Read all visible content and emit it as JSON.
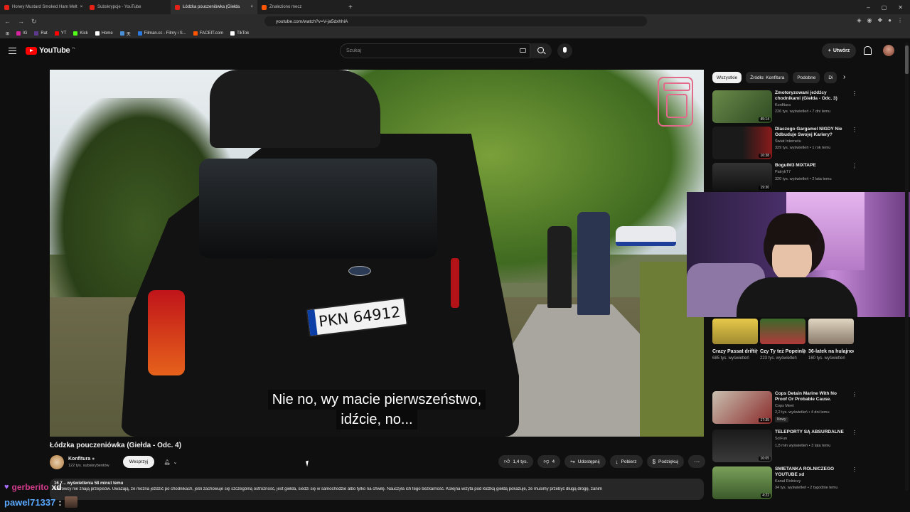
{
  "browser": {
    "tabs": [
      {
        "label": "Honey Mustard Smoked Ham Melt"
      },
      {
        "label": "Subskrypcje - YouTube"
      },
      {
        "label": "Łódzka pouczeniówka (Giełda"
      },
      {
        "label": "Znaleziono mecz"
      }
    ],
    "url": "youtube.com/watch?v=V-ja5dxhhiA",
    "bookmarks": [
      {
        "label": "IG",
        "color": "#d6249f"
      },
      {
        "label": "Rat",
        "color": "#5b3a8c"
      },
      {
        "label": "YT",
        "color": "#ff0000"
      },
      {
        "label": "Kick",
        "color": "#53fc18"
      },
      {
        "label": "Home",
        "color": "#ffffff"
      },
      {
        "label": "天",
        "color": "#4a90d9"
      },
      {
        "label": "Filman.cc - Filmy i S...",
        "color": "#2a7ae2"
      },
      {
        "label": "FACEIT.com",
        "color": "#ff5500"
      },
      {
        "label": "TikTok",
        "color": "#ffffff"
      }
    ]
  },
  "youtube": {
    "logo_text": "YouTube",
    "logo_region": "PL",
    "search_placeholder": "Szukaj",
    "create_label": "Utwórz"
  },
  "player": {
    "subtitle_line1": "Nie no, wy macie pierwszeństwo,",
    "subtitle_line2": "idźcie, no...",
    "plate_text": "PKN 64912"
  },
  "video": {
    "title": "Łódzka pouczeniówka (Giełda - Odc. 4)",
    "channel": "Konfitura",
    "subscribers": "122 tys. subskrybentów",
    "support_label": "Wesprzyj",
    "likes": "1,4 tys.",
    "dislikes": "4",
    "share_label": "Udostępnij",
    "download_label": "Pobierz",
    "thanks_label": "Podziękuj",
    "meta": "16 7... wyświetlenia  58 minut temu",
    "description": "Kierowcy nie znają przepisów. Uważają, że można jeździć po chodnikach, jeśli zachowuje się szczególną ostrożność, jest giełda, siedzi się w samochodzie albo tylko na chwilę. Nauczyła ich tego bezkarność. Kolejna wizyta pod łódzką giełdą pokazuje, że musimy przebyć długą drogę, zanim"
  },
  "sidebar": {
    "chips": [
      "Wszystkie",
      "Źródło: Konfitura",
      "Podobne",
      "Di"
    ],
    "recommendations_top": [
      {
        "title": "Zmotoryzowani jeźdźcy chodnikami (Giełda - Odc. 3)",
        "channel": "Konfitura",
        "meta": "226 tys. wyświetleń • 7 dni temu",
        "duration": "45:14",
        "color": "#4a6a3a"
      },
      {
        "title": "Dlaczego Gargamel NIGDY Nie Odbuduje Swojej Kariery?",
        "channel": "Świat Internetu",
        "meta": "329 tys. wyświetleń • 1 rok temu",
        "duration": "16:38",
        "color": "#5a1a1a"
      },
      {
        "title": "BogulM3 MIXTAPE",
        "channel": "PatrykT7",
        "meta": "320 tys. wyświetleń • 2 lata temu",
        "duration": "19:30",
        "color": "#2a2a2a"
      }
    ],
    "shorts": [
      {
        "title": "Crazy Passat drifting on ...",
        "views": "685 tys. wyświetleń",
        "color": "#d8c050"
      },
      {
        "title": "Czy Ty też Popeinlasz ...",
        "views": "223 tys. wyświetleń",
        "color": "#b03a3a"
      },
      {
        "title": "36-latek na hulajnodze ...",
        "views": "160 tys. wyświetleń",
        "color": "#c9b79a"
      }
    ],
    "recommendations_bottom": [
      {
        "title": "Cops Detain Marine With No Proof Or Probable Cause.",
        "channel": "Cops Meet",
        "meta": "2,2 tys. wyświetleń • 4 dni temu",
        "badge": "Nowy",
        "duration": "17:35",
        "color": "#7a2a2a"
      },
      {
        "title": "TELEPORTY SĄ ABSURDALNE",
        "channel": "SciFun",
        "meta": "1,8 mln wyświetleń • 3 lata temu",
        "duration": "16:05",
        "color": "#1a1a1a"
      },
      {
        "title": "ŚMIETANKA ROLNICZEGO YOUTUBE xd",
        "channel": "Kanał Rolniczy",
        "meta": "34 tys. wyświetleń • 2 tygodnie temu",
        "duration": "4:22",
        "color": "#3a5a2a"
      }
    ]
  },
  "chat": {
    "user1": "gerberito",
    "msg1": "xd",
    "user2": "pawel71337",
    "sep2": ":"
  }
}
